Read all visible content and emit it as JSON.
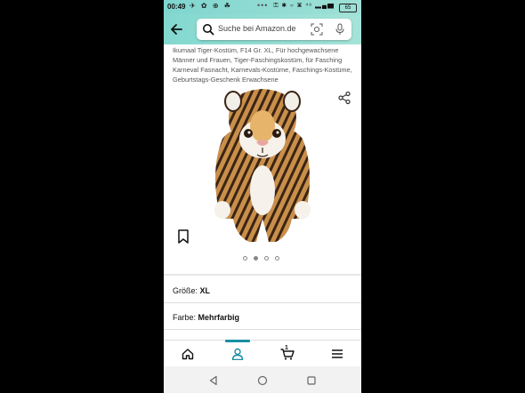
{
  "status_bar": {
    "time": "00:49",
    "left_icons": "✈ ✿ ⊕ ☘",
    "dots": "•••",
    "right_icons": "⚿ ✱ ⌔ ▣ ⁴⁶ ▂▄▆",
    "battery": "65"
  },
  "search": {
    "placeholder": "Suche bei Amazon.de"
  },
  "product": {
    "title": "Ikumaal Tiger-Kostüm, F14 Gr. XL, Für hochgewachsene Männer und Frauen, Tiger-Faschingskostüm, für Fasching Karneval Fasnacht, Karnevals-Kostüme, Faschings-Kostüme, Geburtstags-Geschenk Erwachsene",
    "image_icon": "tiger-costume-image",
    "carousel_count": 4,
    "carousel_active": 1
  },
  "options": {
    "size_label": "Größe:",
    "size_value": "XL",
    "color_label": "Farbe:",
    "color_value": "Mehrfarbig"
  },
  "bottom_nav": {
    "items": [
      "home-icon",
      "account-icon",
      "cart-icon",
      "menu-icon"
    ],
    "active": "account-icon",
    "cart_count": "1"
  },
  "colors": {
    "header_teal": "#82d8cf",
    "accent": "#1a8fa3"
  }
}
